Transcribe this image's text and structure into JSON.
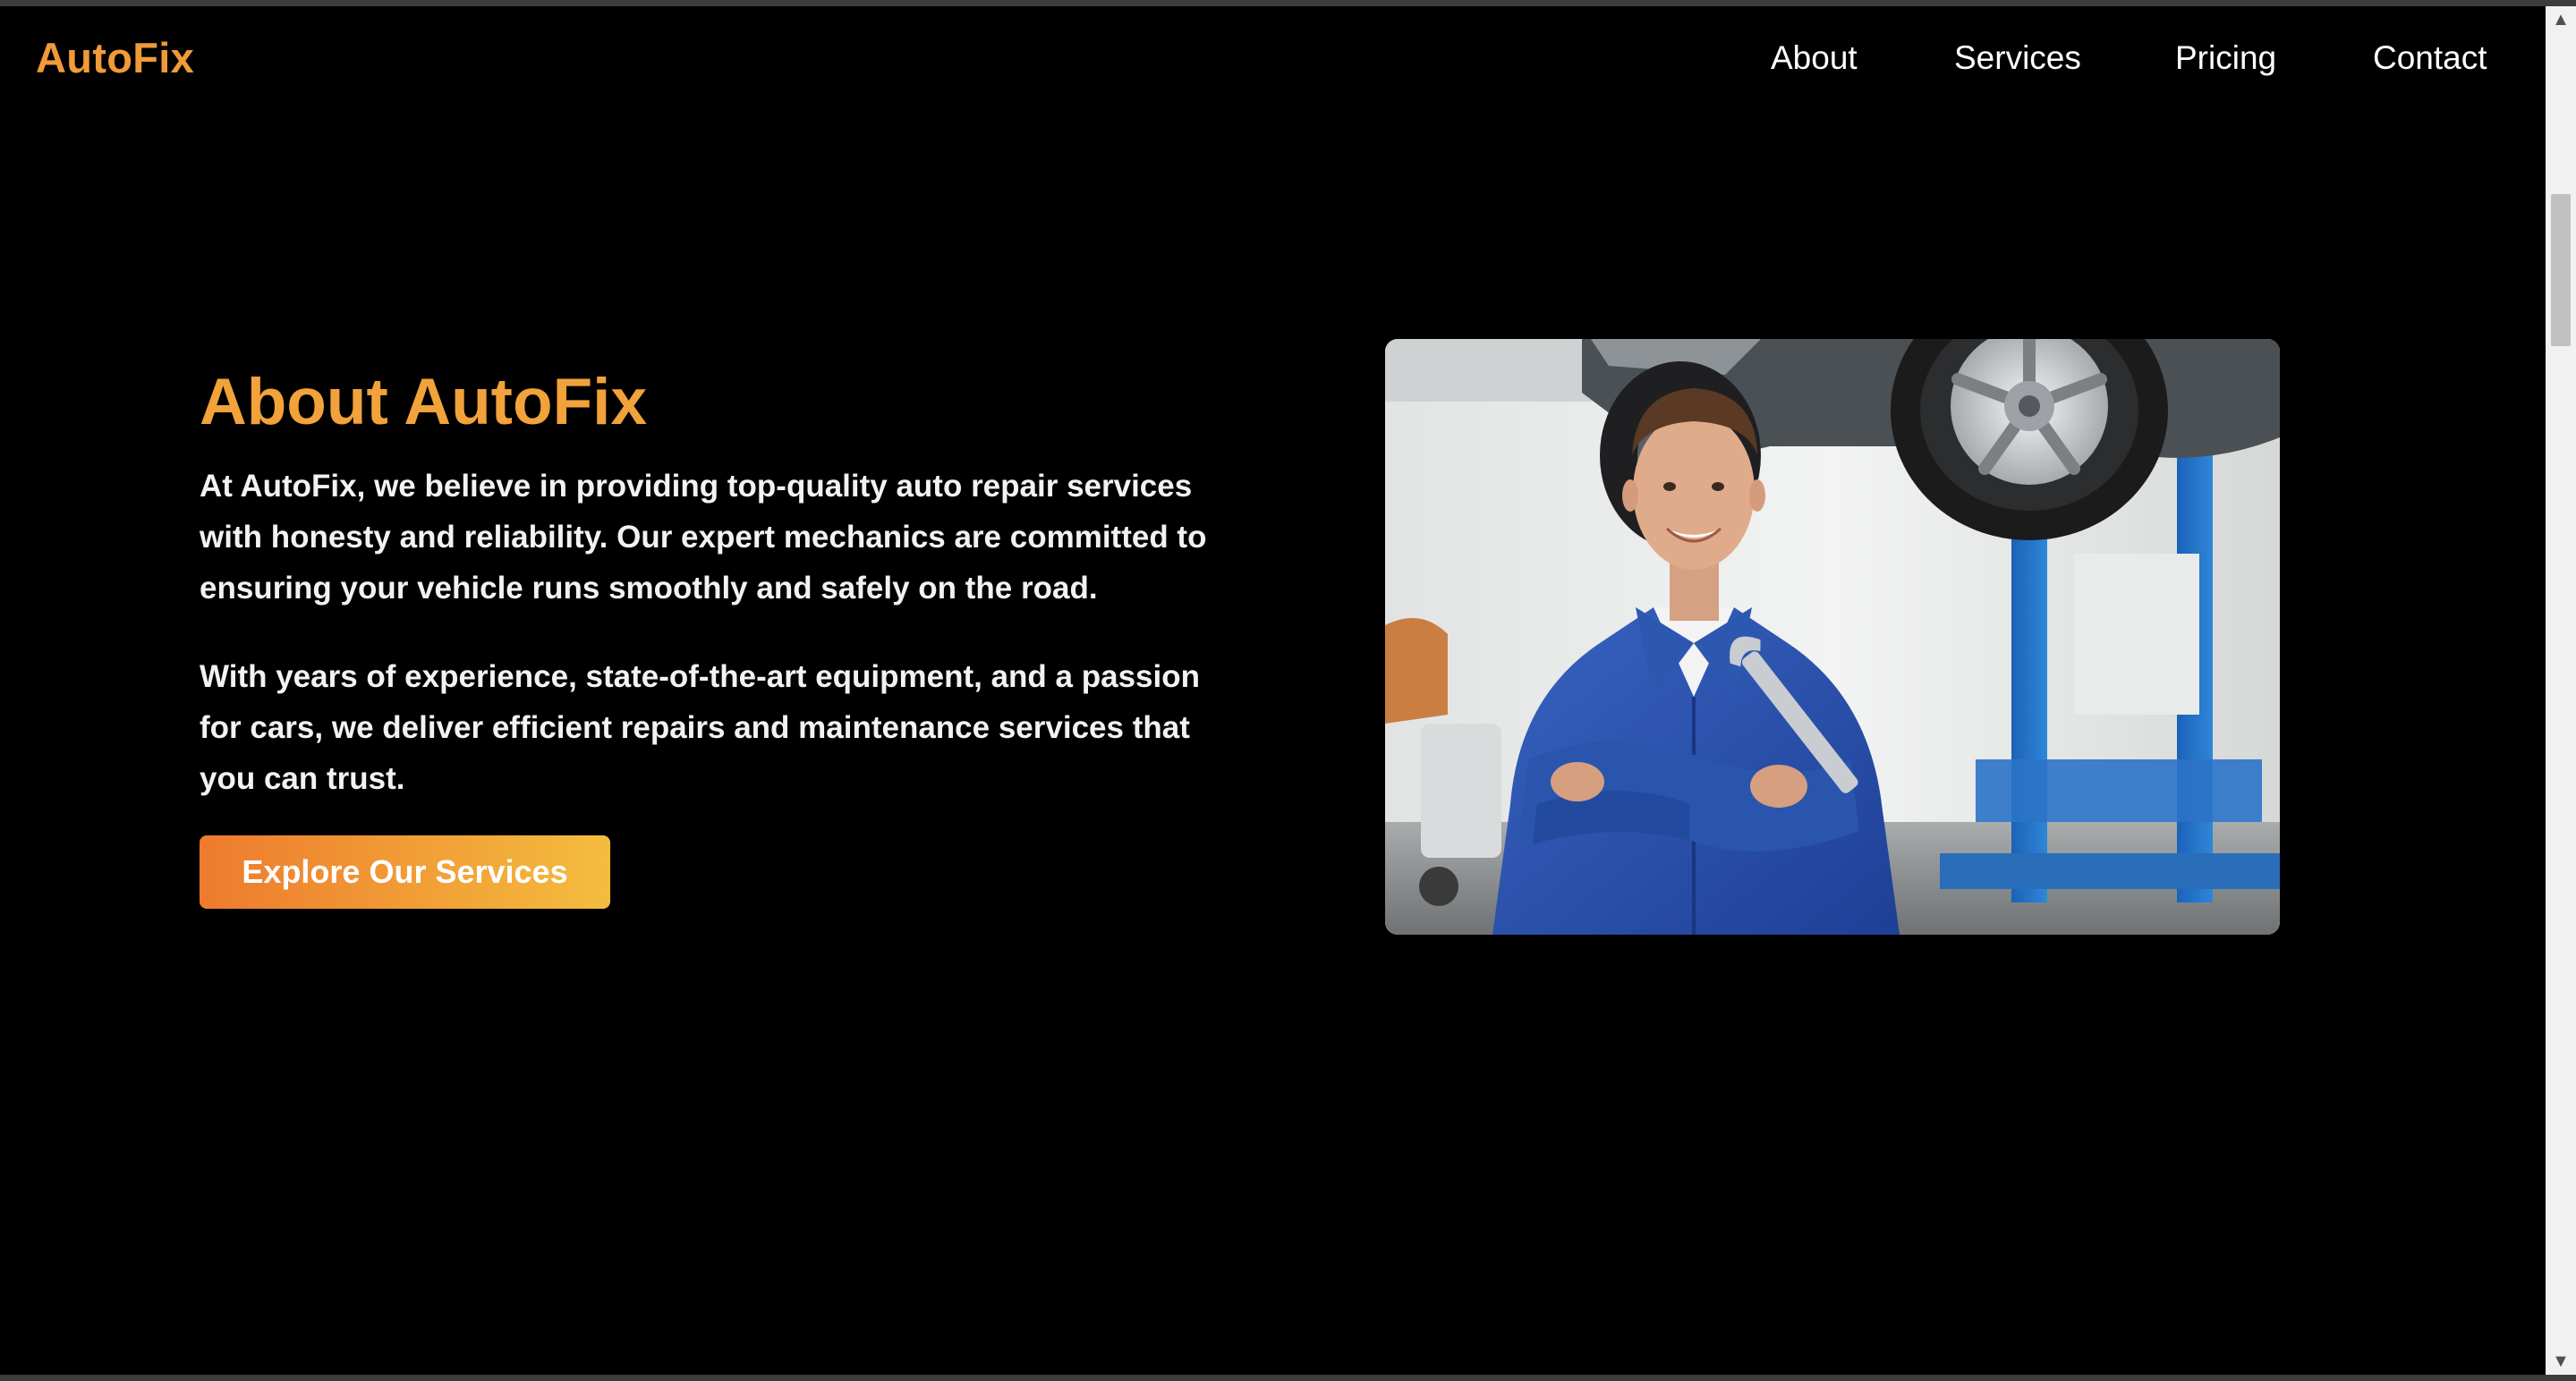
{
  "brand": {
    "logo_text": "AutoFix"
  },
  "nav": {
    "items": [
      {
        "label": "About"
      },
      {
        "label": "Services"
      },
      {
        "label": "Pricing"
      },
      {
        "label": "Contact"
      }
    ]
  },
  "about": {
    "title": "About AutoFix",
    "paragraphs": [
      "At AutoFix, we believe in providing top-quality auto repair services with honesty and reliability. Our expert mechanics are committed to ensuring your vehicle runs smoothly and safely on the road.",
      "With years of experience, state-of-the-art equipment, and a passion for cars, we deliver efficient repairs and maintenance services that you can trust."
    ],
    "cta_label": "Explore Our Services",
    "image_alt": "Smiling mechanic in blue overalls holding a wrench under a lifted car"
  },
  "colors": {
    "background": "#000000",
    "accent": "#f2a23a",
    "cta_gradient_start": "#ee7a2e",
    "cta_gradient_end": "#f4bd3e"
  },
  "icons": {
    "scroll_up": "scroll-up-icon",
    "scroll_down": "scroll-down-icon"
  }
}
